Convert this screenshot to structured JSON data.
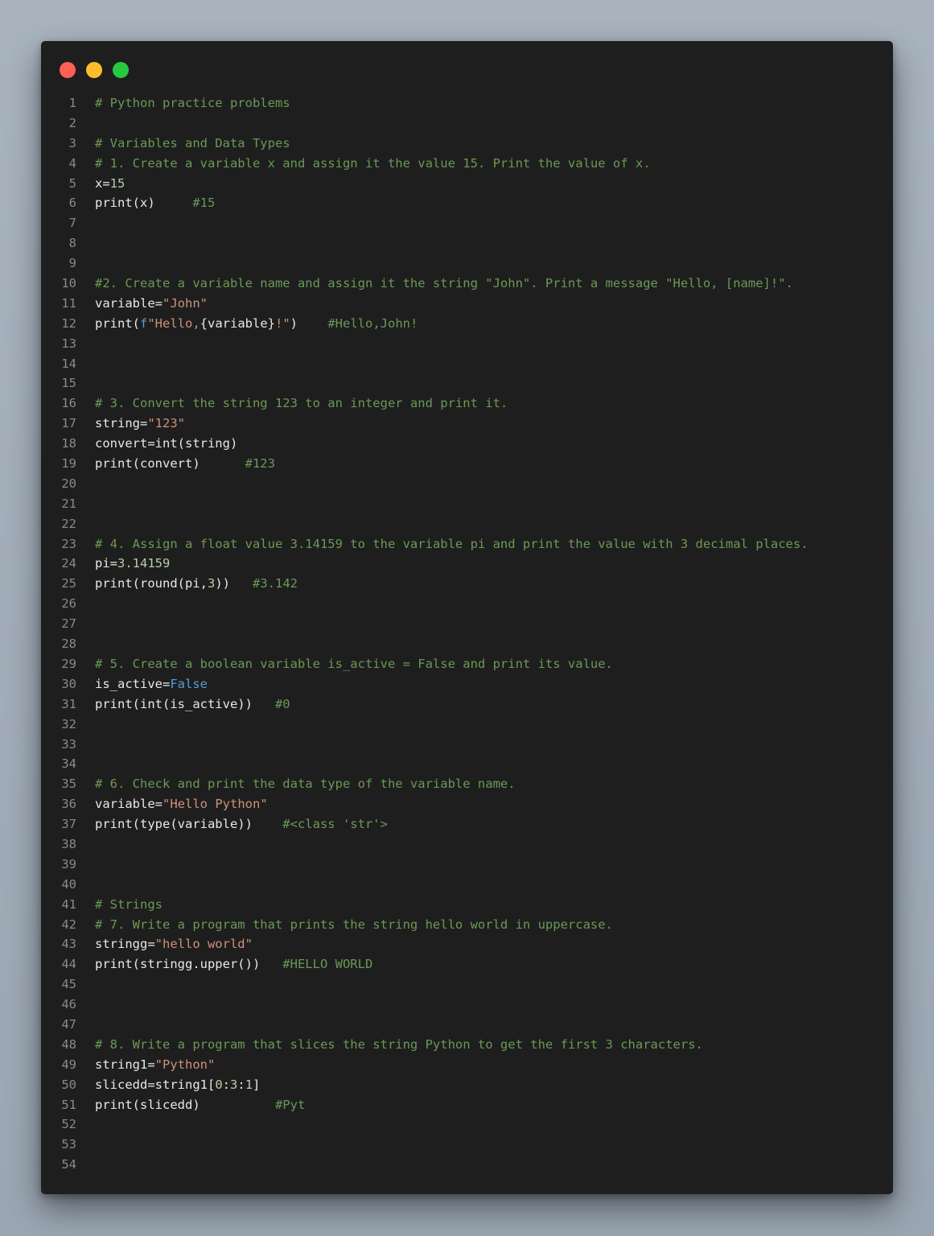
{
  "colors": {
    "background": "#9aa6b2",
    "editor_bg": "#1e1e1e",
    "line_number": "#8a8a8a",
    "plain": "#e8e8e8",
    "comment": "#6a9955",
    "string": "#ce9178",
    "keyword": "#569cd6",
    "number": "#b5cea8",
    "dot_red": "#ff5f56",
    "dot_yellow": "#ffbd2e",
    "dot_green": "#27c93f"
  },
  "window_controls": [
    "close-dot",
    "minimize-dot",
    "maximize-dot"
  ],
  "lines": [
    {
      "n": "1",
      "tokens": [
        {
          "t": "comment",
          "v": "# Python practice problems"
        }
      ]
    },
    {
      "n": "2",
      "tokens": []
    },
    {
      "n": "3",
      "tokens": [
        {
          "t": "comment",
          "v": "# Variables and Data Types"
        }
      ]
    },
    {
      "n": "4",
      "tokens": [
        {
          "t": "comment",
          "v": "# 1. Create a variable x and assign it the value 15. Print the value of x."
        }
      ]
    },
    {
      "n": "5",
      "tokens": [
        {
          "t": "plain",
          "v": "x="
        },
        {
          "t": "number",
          "v": "15"
        }
      ]
    },
    {
      "n": "6",
      "tokens": [
        {
          "t": "plain",
          "v": "print(x)     "
        },
        {
          "t": "comment",
          "v": "#15"
        }
      ]
    },
    {
      "n": "7",
      "tokens": []
    },
    {
      "n": "8",
      "tokens": []
    },
    {
      "n": "9",
      "tokens": []
    },
    {
      "n": "10",
      "tokens": [
        {
          "t": "comment",
          "v": "#2. Create a variable name and assign it the string \"John\". Print a message \"Hello, [name]!\"."
        }
      ]
    },
    {
      "n": "11",
      "tokens": [
        {
          "t": "plain",
          "v": "variable="
        },
        {
          "t": "string",
          "v": "\"John\""
        }
      ]
    },
    {
      "n": "12",
      "tokens": [
        {
          "t": "plain",
          "v": "print("
        },
        {
          "t": "keyword",
          "v": "f"
        },
        {
          "t": "string",
          "v": "\"Hello,"
        },
        {
          "t": "plain",
          "v": "{variable}"
        },
        {
          "t": "string",
          "v": "!\""
        },
        {
          "t": "plain",
          "v": ")    "
        },
        {
          "t": "comment",
          "v": "#Hello,John!"
        }
      ]
    },
    {
      "n": "13",
      "tokens": []
    },
    {
      "n": "14",
      "tokens": []
    },
    {
      "n": "15",
      "tokens": []
    },
    {
      "n": "16",
      "tokens": [
        {
          "t": "comment",
          "v": "# 3. Convert the string 123 to an integer and print it."
        }
      ]
    },
    {
      "n": "17",
      "tokens": [
        {
          "t": "plain",
          "v": "string="
        },
        {
          "t": "string",
          "v": "\"123\""
        }
      ]
    },
    {
      "n": "18",
      "tokens": [
        {
          "t": "plain",
          "v": "convert=int(string)"
        }
      ]
    },
    {
      "n": "19",
      "tokens": [
        {
          "t": "plain",
          "v": "print(convert)      "
        },
        {
          "t": "comment",
          "v": "#123"
        }
      ]
    },
    {
      "n": "20",
      "tokens": []
    },
    {
      "n": "21",
      "tokens": []
    },
    {
      "n": "22",
      "tokens": []
    },
    {
      "n": "23",
      "tokens": [
        {
          "t": "comment",
          "v": "# 4. Assign a float value 3.14159 to the variable pi and print the value with 3 decimal places."
        }
      ]
    },
    {
      "n": "24",
      "tokens": [
        {
          "t": "plain",
          "v": "pi="
        },
        {
          "t": "number",
          "v": "3.14159"
        }
      ]
    },
    {
      "n": "25",
      "tokens": [
        {
          "t": "plain",
          "v": "print(round(pi,"
        },
        {
          "t": "number",
          "v": "3"
        },
        {
          "t": "plain",
          "v": "))   "
        },
        {
          "t": "comment",
          "v": "#3.142"
        }
      ]
    },
    {
      "n": "26",
      "tokens": []
    },
    {
      "n": "27",
      "tokens": []
    },
    {
      "n": "28",
      "tokens": []
    },
    {
      "n": "29",
      "tokens": [
        {
          "t": "comment",
          "v": "# 5. Create a boolean variable is_active = False and print its value."
        }
      ]
    },
    {
      "n": "30",
      "tokens": [
        {
          "t": "plain",
          "v": "is_active="
        },
        {
          "t": "keyword",
          "v": "False"
        }
      ]
    },
    {
      "n": "31",
      "tokens": [
        {
          "t": "plain",
          "v": "print(int(is_active))   "
        },
        {
          "t": "comment",
          "v": "#0"
        }
      ]
    },
    {
      "n": "32",
      "tokens": []
    },
    {
      "n": "33",
      "tokens": []
    },
    {
      "n": "34",
      "tokens": []
    },
    {
      "n": "35",
      "tokens": [
        {
          "t": "comment",
          "v": "# 6. Check and print the data type of the variable name."
        }
      ]
    },
    {
      "n": "36",
      "tokens": [
        {
          "t": "plain",
          "v": "variable="
        },
        {
          "t": "string",
          "v": "\"Hello Python\""
        }
      ]
    },
    {
      "n": "37",
      "tokens": [
        {
          "t": "plain",
          "v": "print(type(variable))    "
        },
        {
          "t": "comment",
          "v": "#<class 'str'>"
        }
      ]
    },
    {
      "n": "38",
      "tokens": []
    },
    {
      "n": "39",
      "tokens": []
    },
    {
      "n": "40",
      "tokens": []
    },
    {
      "n": "41",
      "tokens": [
        {
          "t": "comment",
          "v": "# Strings"
        }
      ]
    },
    {
      "n": "42",
      "tokens": [
        {
          "t": "comment",
          "v": "# 7. Write a program that prints the string hello world in uppercase."
        }
      ]
    },
    {
      "n": "43",
      "tokens": [
        {
          "t": "plain",
          "v": "stringg="
        },
        {
          "t": "string",
          "v": "\"hello world\""
        }
      ]
    },
    {
      "n": "44",
      "tokens": [
        {
          "t": "plain",
          "v": "print(stringg.upper())   "
        },
        {
          "t": "comment",
          "v": "#HELLO WORLD"
        }
      ]
    },
    {
      "n": "45",
      "tokens": []
    },
    {
      "n": "46",
      "tokens": []
    },
    {
      "n": "47",
      "tokens": []
    },
    {
      "n": "48",
      "tokens": [
        {
          "t": "comment",
          "v": "# 8. Write a program that slices the string Python to get the first 3 characters."
        }
      ]
    },
    {
      "n": "49",
      "tokens": [
        {
          "t": "plain",
          "v": "string1="
        },
        {
          "t": "string",
          "v": "\"Python\""
        }
      ]
    },
    {
      "n": "50",
      "tokens": [
        {
          "t": "plain",
          "v": "slicedd=string1["
        },
        {
          "t": "number",
          "v": "0"
        },
        {
          "t": "plain",
          "v": ":"
        },
        {
          "t": "number",
          "v": "3"
        },
        {
          "t": "plain",
          "v": ":"
        },
        {
          "t": "number",
          "v": "1"
        },
        {
          "t": "plain",
          "v": "]"
        }
      ]
    },
    {
      "n": "51",
      "tokens": [
        {
          "t": "plain",
          "v": "print(slicedd)          "
        },
        {
          "t": "comment",
          "v": "#Pyt"
        }
      ]
    },
    {
      "n": "52",
      "tokens": []
    },
    {
      "n": "53",
      "tokens": []
    },
    {
      "n": "54",
      "tokens": []
    }
  ]
}
